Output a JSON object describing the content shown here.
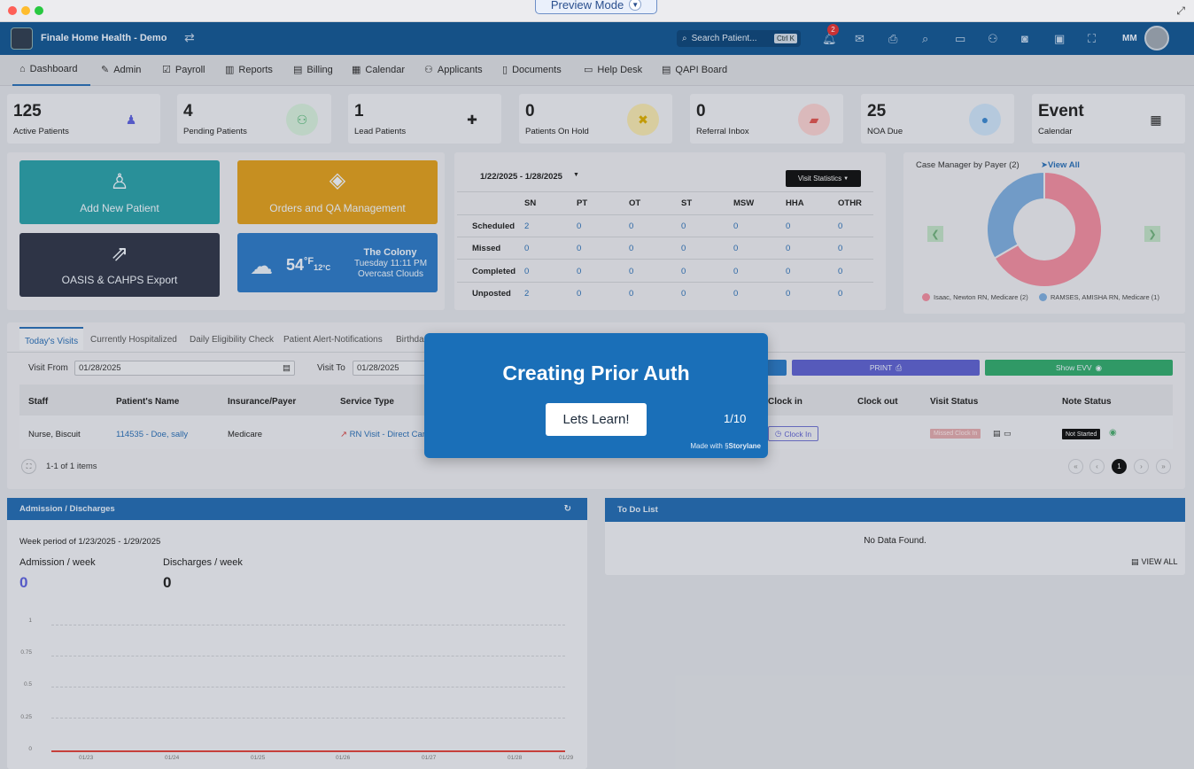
{
  "preview": {
    "label": "Preview Mode"
  },
  "app": {
    "title": "Finale Home Health - Demo"
  },
  "search": {
    "placeholder": "Search Patient...",
    "shortcut": "Ctrl K"
  },
  "notifications": {
    "count": "2"
  },
  "user": {
    "initials": "MM"
  },
  "nav": [
    {
      "label": "Dashboard",
      "icon": "home-icon"
    },
    {
      "label": "Admin",
      "icon": "wrench-icon"
    },
    {
      "label": "Payroll",
      "icon": "edit-icon"
    },
    {
      "label": "Reports",
      "icon": "bar-chart-icon"
    },
    {
      "label": "Billing",
      "icon": "clipboard-icon"
    },
    {
      "label": "Calendar",
      "icon": "calendar-icon"
    },
    {
      "label": "Applicants",
      "icon": "applicants-icon"
    },
    {
      "label": "Documents",
      "icon": "pdf-icon"
    },
    {
      "label": "Help Desk",
      "icon": "ticket-icon"
    },
    {
      "label": "QAPI Board",
      "icon": "clipboard-list-icon"
    }
  ],
  "stats": [
    {
      "value": "125",
      "label": "Active Patients",
      "icon": "person-icon",
      "color": "#5b5fd6"
    },
    {
      "value": "4",
      "label": "Pending Patients",
      "icon": "users-icon",
      "color": "#4caf70"
    },
    {
      "value": "1",
      "label": "Lead Patients",
      "icon": "user-plus-icon",
      "color": "#222222"
    },
    {
      "value": "0",
      "label": "Patients On Hold",
      "icon": "user-times-icon",
      "color": "#e0b400"
    },
    {
      "value": "0",
      "label": "Referral Inbox",
      "icon": "briefcase-icon",
      "color": "#d9534f"
    },
    {
      "value": "25",
      "label": "NOA Due",
      "icon": "user-icon",
      "color": "#3a84c9"
    },
    {
      "value": "Event",
      "label": "Calendar",
      "icon": "calendar-icon",
      "color": "#222222"
    }
  ],
  "tiles": {
    "add_patient": "Add New Patient",
    "orders": "Orders and QA Management",
    "oasis": "OASIS & CAHPS Export",
    "weather": {
      "temp": "54",
      "unit_f": "°F",
      "temp_c": "12",
      "unit_c": "°C",
      "city": "The Colony",
      "time": "Tuesday 11:11 PM",
      "conditions": "Overcast Clouds"
    }
  },
  "visit_stats": {
    "range": "1/22/2025 - 1/28/2025",
    "button": "Visit Statistics",
    "columns": [
      "SN",
      "PT",
      "OT",
      "ST",
      "MSW",
      "HHA",
      "OTHR"
    ],
    "rows": [
      {
        "label": "Scheduled",
        "values": [
          "2",
          "0",
          "0",
          "0",
          "0",
          "0",
          "0"
        ]
      },
      {
        "label": "Missed",
        "values": [
          "0",
          "0",
          "0",
          "0",
          "0",
          "0",
          "0"
        ]
      },
      {
        "label": "Completed",
        "values": [
          "0",
          "0",
          "0",
          "0",
          "0",
          "0",
          "0"
        ]
      },
      {
        "label": "Unposted",
        "values": [
          "2",
          "0",
          "0",
          "0",
          "0",
          "0",
          "0"
        ]
      }
    ]
  },
  "case_manager": {
    "title": "Case Manager by Payer",
    "count": "(2)",
    "view_all": "View All",
    "legend": [
      {
        "label": "Isaac, Newton RN, Medicare (2)",
        "color": "#e8889a"
      },
      {
        "label": "RAMSES, AMISHA RN, Medicare (1)",
        "color": "#7aa7d6"
      }
    ]
  },
  "chart_data": {
    "type": "pie",
    "title": "Case Manager by Payer",
    "categories": [
      "Isaac, Newton RN, Medicare",
      "RAMSES, AMISHA RN, Medicare"
    ],
    "values": [
      2,
      1
    ],
    "colors": [
      "#e8889a",
      "#7aa7d6"
    ],
    "legend": "bottom"
  },
  "visit_tabs": [
    "Today's Visits",
    "Currently Hospitalized",
    "Daily Eligibility Check",
    "Patient Alert-Notifications",
    "Birthda"
  ],
  "visit_filters": {
    "from_label": "Visit From",
    "from_value": "01/28/2025",
    "to_label": "Visit To",
    "to_value": "01/28/2025"
  },
  "visit_buttons": {
    "print": "PRINT",
    "evv": "Show EVV"
  },
  "visit_table": {
    "headers": [
      "Staff",
      "Patient's Name",
      "Insurance/Payer",
      "Service Type",
      "Clock in",
      "Clock out",
      "Visit Status",
      "Note Status"
    ],
    "row": {
      "staff": "Nurse, Biscuit",
      "patient": "114535 - Doe, sally",
      "payer": "Medicare",
      "service": "RN Visit - Direct Care",
      "clock_in": "Clock In",
      "visit_status": "Missed Clock In",
      "note_status": "Not Started"
    }
  },
  "pager": {
    "summary": "1-1 of 1 items",
    "page": "1"
  },
  "admission": {
    "title": "Admission / Discharges",
    "period": "Week period of 1/23/2025 - 1/29/2025",
    "admission_label": "Admission / week",
    "admission_value": "0",
    "discharge_label": "Discharges / week",
    "discharge_value": "0",
    "y_ticks": [
      "1",
      "0.75",
      "0.5",
      "0.25",
      "0"
    ],
    "x_ticks": [
      "01/23",
      "01/24",
      "01/25",
      "01/26",
      "01/27",
      "01/28",
      "01/29"
    ]
  },
  "todo": {
    "title": "To Do List",
    "empty": "No Data Found.",
    "view_all": "VIEW ALL"
  },
  "tour": {
    "title": "Creating Prior Auth",
    "button": "Lets Learn!",
    "step": "1/10",
    "made_with": "Made with",
    "brand": "Storylane"
  }
}
